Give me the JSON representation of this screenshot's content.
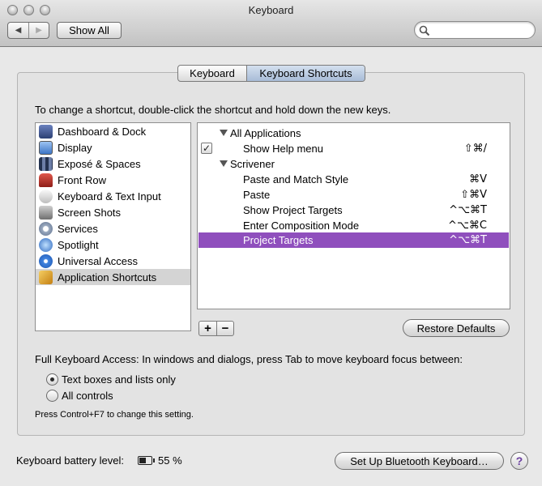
{
  "window": {
    "title": "Keyboard"
  },
  "toolbar": {
    "back_icon": "back-arrow-icon",
    "forward_icon": "forward-arrow-icon",
    "show_all_label": "Show All",
    "search_placeholder": ""
  },
  "tabs": [
    {
      "label": "Keyboard",
      "selected": false
    },
    {
      "label": "Keyboard Shortcuts",
      "selected": true
    }
  ],
  "instructions": "To change a shortcut, double-click the shortcut and hold down the new keys.",
  "categories": [
    {
      "label": "Dashboard & Dock",
      "icon": "dashboard-dock-icon",
      "color": "#3a4f86"
    },
    {
      "label": "Display",
      "icon": "display-icon",
      "color": "#4f84cf"
    },
    {
      "label": "Exposé & Spaces",
      "icon": "expose-spaces-icon",
      "color": "#3b4a6b"
    },
    {
      "label": "Front Row",
      "icon": "front-row-icon",
      "color": "#c0352c"
    },
    {
      "label": "Keyboard & Text Input",
      "icon": "keyboard-icon",
      "color": "#d8d8d8"
    },
    {
      "label": "Screen Shots",
      "icon": "screenshot-icon",
      "color": "#8a8a8a"
    },
    {
      "label": "Services",
      "icon": "gear-icon",
      "color": "#7d8fa8"
    },
    {
      "label": "Spotlight",
      "icon": "spotlight-icon",
      "color": "#3f79c9"
    },
    {
      "label": "Universal Access",
      "icon": "universal-access-icon",
      "color": "#2f6fcf"
    },
    {
      "label": "Application Shortcuts",
      "icon": "app-shortcuts-icon",
      "color": "#e0a72a",
      "selected": true
    }
  ],
  "shortcuts": {
    "group1": {
      "label": "All Applications"
    },
    "help_item": {
      "name": "Show Help menu",
      "key": "⇧⌘/",
      "checked": true
    },
    "group2": {
      "label": "Scrivener"
    },
    "items": [
      {
        "name": "Paste and Match Style",
        "key": "⌘V"
      },
      {
        "name": "Paste",
        "key": "⇧⌘V"
      },
      {
        "name": "Show Project Targets",
        "key": "^⌥⌘T"
      },
      {
        "name": "Enter Composition Mode",
        "key": "^⌥⌘C"
      },
      {
        "name": "Project Targets",
        "key": "^⌥⌘T",
        "highlight_color": "#8f4fbd"
      }
    ]
  },
  "controls": {
    "add_label": "+",
    "remove_label": "−",
    "restore_label": "Restore Defaults"
  },
  "full_access": {
    "label": "Full Keyboard Access: In windows and dialogs, press Tab to move keyboard focus between:",
    "options": [
      {
        "label": "Text boxes and lists only",
        "selected": true
      },
      {
        "label": "All controls",
        "selected": false
      }
    ],
    "note": "Press Control+F7 to change this setting."
  },
  "battery": {
    "label": "Keyboard battery level:",
    "value": "55 %",
    "level": 0.55
  },
  "bluetooth_button": "Set Up Bluetooth Keyboard…",
  "help_label": "?"
}
